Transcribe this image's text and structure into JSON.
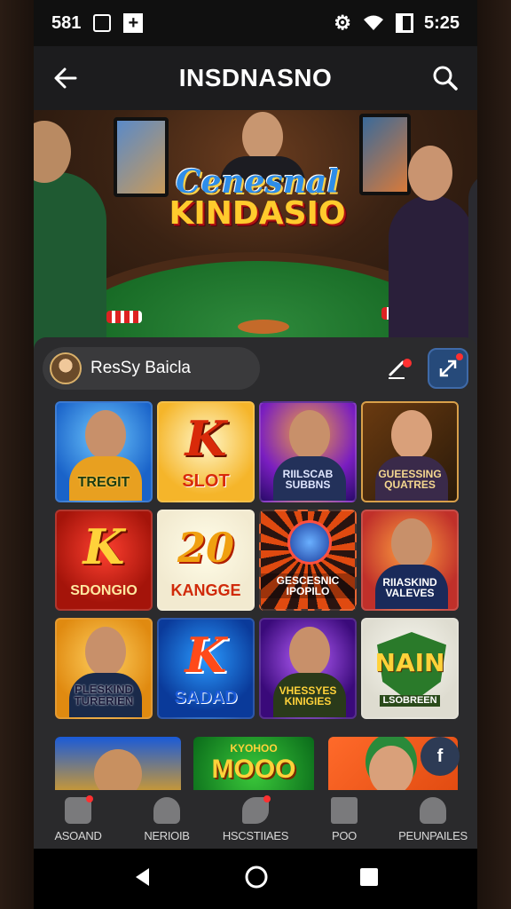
{
  "status_bar": {
    "left_text": "581",
    "time": "5:25"
  },
  "app_bar": {
    "title": "INSDNASNO"
  },
  "hero": {
    "logo_line1": "Cenesnal",
    "logo_line2": "KINDASIO"
  },
  "user": {
    "name": "ResSy Baicla"
  },
  "tiles": [
    {
      "label": "TREGIT",
      "big": ""
    },
    {
      "label": "SLOT",
      "big": "K"
    },
    {
      "label": "RIILSCAB SUBBNS",
      "big": ""
    },
    {
      "label": "GUEESSING QUATRES",
      "big": ""
    },
    {
      "label": "SDONGIO",
      "big": "K"
    },
    {
      "label": "KANGGE",
      "big": "20"
    },
    {
      "label": "GESCESNIC IPOPILO",
      "big": ""
    },
    {
      "label": "RIIASKIND VALEVES",
      "big": ""
    },
    {
      "label": "PLESKIND TURERIEN",
      "big": ""
    },
    {
      "label": "SADAD",
      "big": "K"
    },
    {
      "label": "VHESSYES KINIGIES",
      "big": ""
    },
    {
      "label": "LSOBREEN",
      "big": "NAIN"
    }
  ],
  "row4": {
    "middle_label": "MOOO",
    "middle_top": "KYOHOO"
  },
  "fab": {
    "label": "f"
  },
  "bottom_nav": [
    {
      "label": "ASOAND"
    },
    {
      "label": "NERIOIB"
    },
    {
      "label": "HSCSTIIAES"
    },
    {
      "label": "POO"
    },
    {
      "label": "PEUNPAILES"
    }
  ],
  "colors": {
    "accent": "#2e8de8",
    "gold": "#ffcb2d",
    "felt": "#1f7a2e"
  }
}
